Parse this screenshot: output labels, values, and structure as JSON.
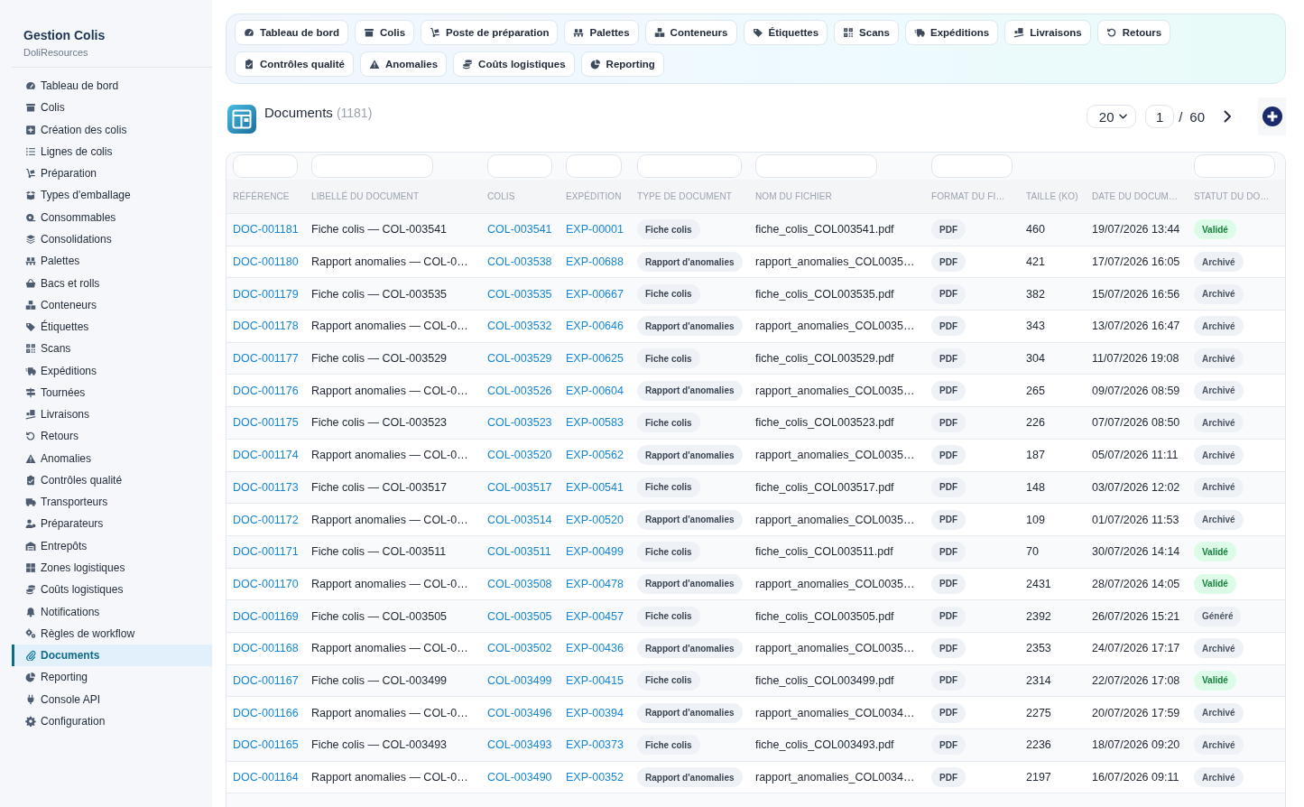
{
  "sidebar": {
    "brand": "Gestion Colis",
    "subtitle": "DoliResources",
    "items": [
      {
        "label": "Tableau de bord",
        "selected": false
      },
      {
        "label": "Colis",
        "selected": false
      },
      {
        "label": "Création des colis",
        "selected": false
      },
      {
        "label": "Lignes de colis",
        "selected": false
      },
      {
        "label": "Préparation",
        "selected": false
      },
      {
        "label": "Types d'emballage",
        "selected": false
      },
      {
        "label": "Consommables",
        "selected": false
      },
      {
        "label": "Consolidations",
        "selected": false
      },
      {
        "label": "Palettes",
        "selected": false
      },
      {
        "label": "Bacs et rolls",
        "selected": false
      },
      {
        "label": "Conteneurs",
        "selected": false
      },
      {
        "label": "Étiquettes",
        "selected": false
      },
      {
        "label": "Scans",
        "selected": false
      },
      {
        "label": "Expéditions",
        "selected": false
      },
      {
        "label": "Tournées",
        "selected": false
      },
      {
        "label": "Livraisons",
        "selected": false
      },
      {
        "label": "Retours",
        "selected": false
      },
      {
        "label": "Anomalies",
        "selected": false
      },
      {
        "label": "Contrôles qualité",
        "selected": false
      },
      {
        "label": "Transporteurs",
        "selected": false
      },
      {
        "label": "Préparateurs",
        "selected": false
      },
      {
        "label": "Entrepôts",
        "selected": false
      },
      {
        "label": "Zones logistiques",
        "selected": false
      },
      {
        "label": "Coûts logistiques",
        "selected": false
      },
      {
        "label": "Notifications",
        "selected": false
      },
      {
        "label": "Règles de workflow",
        "selected": false
      },
      {
        "label": "Documents",
        "selected": true
      },
      {
        "label": "Reporting",
        "selected": false
      },
      {
        "label": "Console API",
        "selected": false
      },
      {
        "label": "Configuration",
        "selected": false
      }
    ]
  },
  "nav": {
    "rows": [
      [
        "Tableau de bord",
        "Colis",
        "Poste de préparation",
        "Palettes",
        "Conteneurs",
        "Étiquettes",
        "Scans",
        "Expéditions",
        "Livraisons",
        "Retours"
      ],
      [
        "Contrôles qualité",
        "Anomalies",
        "Coûts logistiques",
        "Reporting"
      ]
    ]
  },
  "header": {
    "title": "Documents",
    "count": "(1181)",
    "page_size": "20",
    "page": "1",
    "separator": "/",
    "page_count": "60"
  },
  "table": {
    "columns": [
      {
        "label": "RÉFÉRENCE",
        "filter": true
      },
      {
        "label": "LIBELLÉ DU DOCUMENT",
        "filter": true
      },
      {
        "label": "COLIS",
        "filter": true
      },
      {
        "label": "EXPÉDITION",
        "filter": true
      },
      {
        "label": "TYPE DE DOCUMENT",
        "filter": true
      },
      {
        "label": "NOM DU FICHIER",
        "filter": true
      },
      {
        "label": "FORMAT DU FI…",
        "filter": true
      },
      {
        "label": "TAILLE (KO)",
        "filter": false
      },
      {
        "label": "DATE DU DOCUM…",
        "filter": false
      },
      {
        "label": "STATUT DU DO…",
        "filter": true
      }
    ],
    "rows": [
      {
        "reference": "DOC-001181",
        "label": "Fiche colis — COL-003541",
        "colis": "COL-003541",
        "expedition": "EXP-00001",
        "type": "Fiche colis",
        "file": "fiche_colis_COL003541.pdf",
        "format": "PDF",
        "size": "460",
        "date": "19/07/2026 13:44",
        "status": {
          "label": "Validé",
          "kind": "success"
        }
      },
      {
        "reference": "DOC-001180",
        "label": "Rapport anomalies — COL-0…",
        "colis": "COL-003538",
        "expedition": "EXP-00688",
        "type": "Rapport d'anomalies",
        "file": "rapport_anomalies_COL0035…",
        "format": "PDF",
        "size": "421",
        "date": "17/07/2026 16:05",
        "status": {
          "label": "Archivé",
          "kind": "neutral"
        }
      },
      {
        "reference": "DOC-001179",
        "label": "Fiche colis — COL-003535",
        "colis": "COL-003535",
        "expedition": "EXP-00667",
        "type": "Fiche colis",
        "file": "fiche_colis_COL003535.pdf",
        "format": "PDF",
        "size": "382",
        "date": "15/07/2026 16:56",
        "status": {
          "label": "Archivé",
          "kind": "neutral"
        }
      },
      {
        "reference": "DOC-001178",
        "label": "Rapport anomalies — COL-0…",
        "colis": "COL-003532",
        "expedition": "EXP-00646",
        "type": "Rapport d'anomalies",
        "file": "rapport_anomalies_COL0035…",
        "format": "PDF",
        "size": "343",
        "date": "13/07/2026 16:47",
        "status": {
          "label": "Archivé",
          "kind": "neutral"
        }
      },
      {
        "reference": "DOC-001177",
        "label": "Fiche colis — COL-003529",
        "colis": "COL-003529",
        "expedition": "EXP-00625",
        "type": "Fiche colis",
        "file": "fiche_colis_COL003529.pdf",
        "format": "PDF",
        "size": "304",
        "date": "11/07/2026 19:08",
        "status": {
          "label": "Archivé",
          "kind": "neutral"
        }
      },
      {
        "reference": "DOC-001176",
        "label": "Rapport anomalies — COL-0…",
        "colis": "COL-003526",
        "expedition": "EXP-00604",
        "type": "Rapport d'anomalies",
        "file": "rapport_anomalies_COL0035…",
        "format": "PDF",
        "size": "265",
        "date": "09/07/2026 08:59",
        "status": {
          "label": "Archivé",
          "kind": "neutral"
        }
      },
      {
        "reference": "DOC-001175",
        "label": "Fiche colis — COL-003523",
        "colis": "COL-003523",
        "expedition": "EXP-00583",
        "type": "Fiche colis",
        "file": "fiche_colis_COL003523.pdf",
        "format": "PDF",
        "size": "226",
        "date": "07/07/2026 08:50",
        "status": {
          "label": "Archivé",
          "kind": "neutral"
        }
      },
      {
        "reference": "DOC-001174",
        "label": "Rapport anomalies — COL-0…",
        "colis": "COL-003520",
        "expedition": "EXP-00562",
        "type": "Rapport d'anomalies",
        "file": "rapport_anomalies_COL0035…",
        "format": "PDF",
        "size": "187",
        "date": "05/07/2026 11:11",
        "status": {
          "label": "Archivé",
          "kind": "neutral"
        }
      },
      {
        "reference": "DOC-001173",
        "label": "Fiche colis — COL-003517",
        "colis": "COL-003517",
        "expedition": "EXP-00541",
        "type": "Fiche colis",
        "file": "fiche_colis_COL003517.pdf",
        "format": "PDF",
        "size": "148",
        "date": "03/07/2026 12:02",
        "status": {
          "label": "Archivé",
          "kind": "neutral"
        }
      },
      {
        "reference": "DOC-001172",
        "label": "Rapport anomalies — COL-0…",
        "colis": "COL-003514",
        "expedition": "EXP-00520",
        "type": "Rapport d'anomalies",
        "file": "rapport_anomalies_COL0035…",
        "format": "PDF",
        "size": "109",
        "date": "01/07/2026 11:53",
        "status": {
          "label": "Archivé",
          "kind": "neutral"
        }
      },
      {
        "reference": "DOC-001171",
        "label": "Fiche colis — COL-003511",
        "colis": "COL-003511",
        "expedition": "EXP-00499",
        "type": "Fiche colis",
        "file": "fiche_colis_COL003511.pdf",
        "format": "PDF",
        "size": "70",
        "date": "30/07/2026 14:14",
        "status": {
          "label": "Validé",
          "kind": "success"
        }
      },
      {
        "reference": "DOC-001170",
        "label": "Rapport anomalies — COL-0…",
        "colis": "COL-003508",
        "expedition": "EXP-00478",
        "type": "Rapport d'anomalies",
        "file": "rapport_anomalies_COL0035…",
        "format": "PDF",
        "size": "2431",
        "date": "28/07/2026 14:05",
        "status": {
          "label": "Validé",
          "kind": "success"
        }
      },
      {
        "reference": "DOC-001169",
        "label": "Fiche colis — COL-003505",
        "colis": "COL-003505",
        "expedition": "EXP-00457",
        "type": "Fiche colis",
        "file": "fiche_colis_COL003505.pdf",
        "format": "PDF",
        "size": "2392",
        "date": "26/07/2026 15:21",
        "status": {
          "label": "Généré",
          "kind": "neutral"
        }
      },
      {
        "reference": "DOC-001168",
        "label": "Rapport anomalies — COL-0…",
        "colis": "COL-003502",
        "expedition": "EXP-00436",
        "type": "Rapport d'anomalies",
        "file": "rapport_anomalies_COL0035…",
        "format": "PDF",
        "size": "2353",
        "date": "24/07/2026 17:17",
        "status": {
          "label": "Archivé",
          "kind": "neutral"
        }
      },
      {
        "reference": "DOC-001167",
        "label": "Fiche colis — COL-003499",
        "colis": "COL-003499",
        "expedition": "EXP-00415",
        "type": "Fiche colis",
        "file": "fiche_colis_COL003499.pdf",
        "format": "PDF",
        "size": "2314",
        "date": "22/07/2026 17:08",
        "status": {
          "label": "Validé",
          "kind": "success"
        }
      },
      {
        "reference": "DOC-001166",
        "label": "Rapport anomalies — COL-0…",
        "colis": "COL-003496",
        "expedition": "EXP-00394",
        "type": "Rapport d'anomalies",
        "file": "rapport_anomalies_COL0034…",
        "format": "PDF",
        "size": "2275",
        "date": "20/07/2026 17:59",
        "status": {
          "label": "Archivé",
          "kind": "neutral"
        }
      },
      {
        "reference": "DOC-001165",
        "label": "Fiche colis — COL-003493",
        "colis": "COL-003493",
        "expedition": "EXP-00373",
        "type": "Fiche colis",
        "file": "fiche_colis_COL003493.pdf",
        "format": "PDF",
        "size": "2236",
        "date": "18/07/2026 09:20",
        "status": {
          "label": "Archivé",
          "kind": "neutral"
        }
      },
      {
        "reference": "DOC-001164",
        "label": "Rapport anomalies — COL-0…",
        "colis": "COL-003490",
        "expedition": "EXP-00352",
        "type": "Rapport d'anomalies",
        "file": "rapport_anomalies_COL0034…",
        "format": "PDF",
        "size": "2197",
        "date": "16/07/2026 09:11",
        "status": {
          "label": "Archivé",
          "kind": "neutral"
        }
      }
    ]
  }
}
